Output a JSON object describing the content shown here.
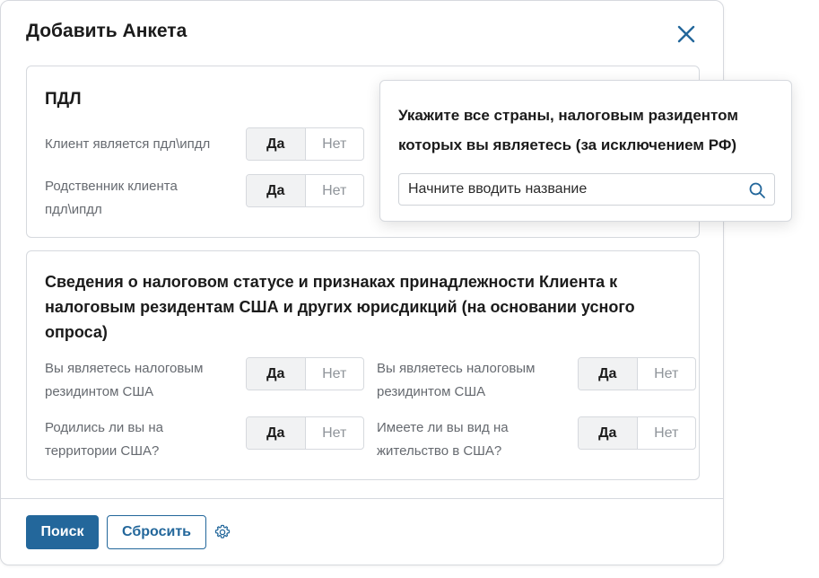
{
  "dialog": {
    "title": "Добавить Анкета"
  },
  "pdl_section": {
    "title": "ПДЛ",
    "rows": [
      {
        "label": "Клиент является пдл\\ипдл",
        "yes": "Да",
        "no": "Нет"
      },
      {
        "label": "Родственник клиента пдл\\ипдл",
        "yes": "Да",
        "no": "Нет"
      }
    ]
  },
  "tax_section": {
    "title": "Сведения о налоговом статусе и признаках принадлежности Клиента к налоговым резидентам США и других юрисдикций (на основании усного опроса)",
    "rows": [
      {
        "label": "Вы являетесь налоговым резидинтом США",
        "yes": "Да",
        "no": "Нет"
      },
      {
        "label": "Вы являетесь налоговым резидинтом США",
        "yes": "Да",
        "no": "Нет"
      },
      {
        "label": "Родились ли вы на территории США?",
        "yes": "Да",
        "no": "Нет"
      },
      {
        "label": "Имеете ли вы вид на жительство в США?",
        "yes": "Да",
        "no": "Нет"
      }
    ]
  },
  "popover": {
    "title": "Укажите все страны, налоговым разидентом которых вы являетесь (за исключением РФ)",
    "input_value": "Начните вводить название"
  },
  "footer": {
    "search_label": "Поиск",
    "reset_label": "Сбросить"
  },
  "colors": {
    "primary": "#23679b",
    "border": "#d6d9de",
    "muted_text": "#666a70"
  },
  "icons": [
    "close-icon",
    "search-icon",
    "gear-icon"
  ]
}
